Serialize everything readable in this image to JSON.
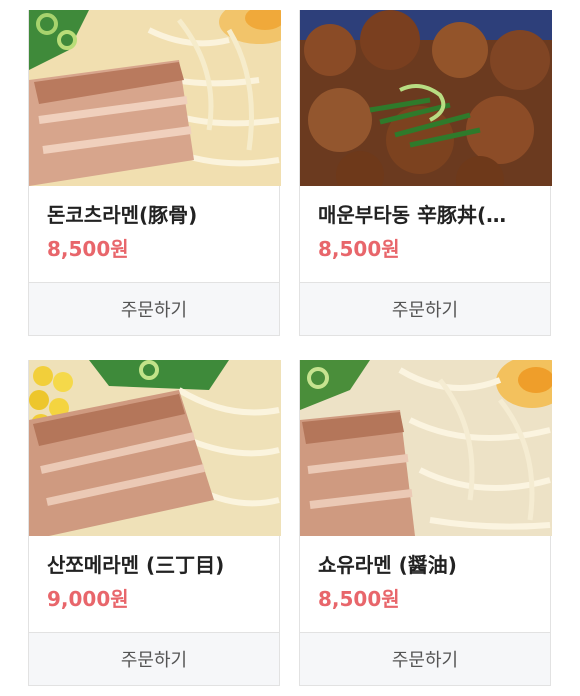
{
  "menu": {
    "items": [
      {
        "name": "돈코츠라멘(豚骨)",
        "price": "8,500원",
        "order_label": "주문하기",
        "photo": "tonkotsu-ramen-photo"
      },
      {
        "name": "매운부타동 辛豚丼(…",
        "price": "8,500원",
        "order_label": "주문하기",
        "photo": "spicy-butadon-photo"
      },
      {
        "name": "산쪼메라멘 (三丁目)",
        "price": "9,000원",
        "order_label": "주문하기",
        "photo": "sanchome-ramen-photo"
      },
      {
        "name": "쇼유라멘 (醤油)",
        "price": "8,500원",
        "order_label": "주문하기",
        "photo": "shoyu-ramen-photo"
      }
    ]
  },
  "colors": {
    "price": "#e8666b",
    "button_bg": "#f6f7f9",
    "border": "#e2e2e2"
  }
}
